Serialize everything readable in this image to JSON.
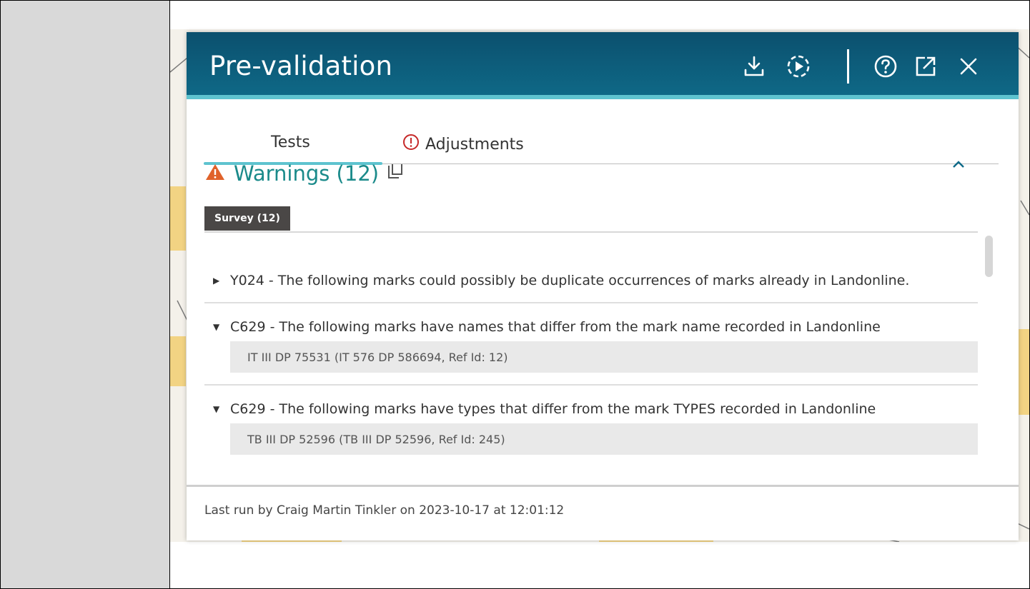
{
  "panel": {
    "title": "Pre-validation"
  },
  "tabs": [
    {
      "label": "Tests"
    },
    {
      "label": "Adjustments"
    }
  ],
  "warnings": {
    "title": "Warnings (12)",
    "chip": "Survey (12)"
  },
  "items": [
    {
      "text": "Y024 - The following marks could possibly be duplicate occurrences of marks already in Landonline.",
      "sub": null
    },
    {
      "text": "C629 - The following marks have names that differ from the mark name recorded in Landonline",
      "sub": "IT III DP 75531 (IT 576 DP 586694, Ref Id: 12)"
    },
    {
      "text": "C629 - The following marks have types that differ from the mark TYPES recorded in Landonline",
      "sub": "TB III DP 52596 (TB III DP 52596, Ref Id: 245)"
    }
  ],
  "footer": {
    "text": "Last run by Craig Martin Tinkler on 2023-10-17 at 12:01:12"
  },
  "colors": {
    "header": "#0e6a88",
    "accent": "#5ec3cf",
    "warning": "#e0622a",
    "warning_text": "#1a8a8a",
    "error": "#c62828"
  }
}
